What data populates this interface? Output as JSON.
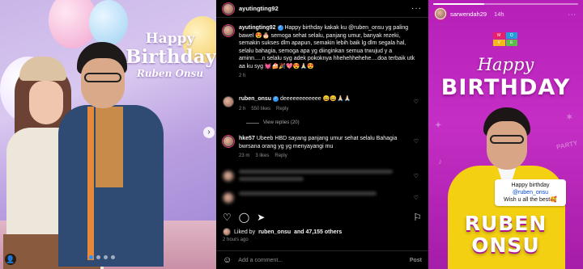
{
  "photo": {
    "banner_line1": "Happy",
    "banner_line2": "Birthday",
    "banner_line3": "Ruben Onsu",
    "carousel_dots": 4,
    "active_dot": 1
  },
  "post": {
    "username": "ayutingting92",
    "caption_user": "ayutingting92",
    "caption_text": "Happy birthday kakak ku @ruben_onsu yg paling bawel 😍🎂 semoga sehat selalu, panjang umur, banyak rezeki, semakin sukses dlm apapun, semakin lebih baik lg dlm segala hal, selalu bahagia, semoga apa yg diinginkan semua trwujud y a aminn.....n selalu syg adek pokoknya hhehehhehehe....doa terbaik utk aa ku syg 💓🍰🎉💖😍🙏🏻😍",
    "caption_time": "2 h",
    "comments": [
      {
        "user": "ruben_onsu",
        "text": "deeeeeeeeeeee 😄😄🙏🏻🙏🏻",
        "time": "2 h",
        "likes": "550 likes",
        "reply": "Reply"
      },
      {
        "user": "hke57",
        "text": "Ubeeb HBD sayang panjang umur sehat selalu Bahagia bwrsana orang yg yg menyayangi mu",
        "time": "23 m",
        "likes": "3 likes",
        "reply": "Reply"
      }
    ],
    "view_replies": "View replies (20)",
    "liked_by_prefix": "Liked by",
    "liked_by_user": "ruben_onsu",
    "liked_by_suffix": "and 47,155 others",
    "posted_ago": "2 hours ago",
    "add_comment_placeholder": "Add a comment...",
    "post_label": "Post"
  },
  "story": {
    "username": "sarwendah29",
    "time": "14h",
    "progress": 0.35,
    "happy": "Happy",
    "birthday": "BIRTHDAY",
    "sticker_line1_prefix": "Happy birthday",
    "sticker_mention": "@ruben_onsu",
    "sticker_line2": "Wish u all the best🥰",
    "name_line1": "RUBEN",
    "name_line2": "ONSU",
    "logo_letters": [
      "M",
      "O",
      "V",
      "E"
    ],
    "doodle_text": "PARTY"
  },
  "colors": {
    "ig_bg": "#000000",
    "verified": "#3897f0",
    "story_bg": "#c52ec5",
    "story_yellow": "#f4d012"
  }
}
